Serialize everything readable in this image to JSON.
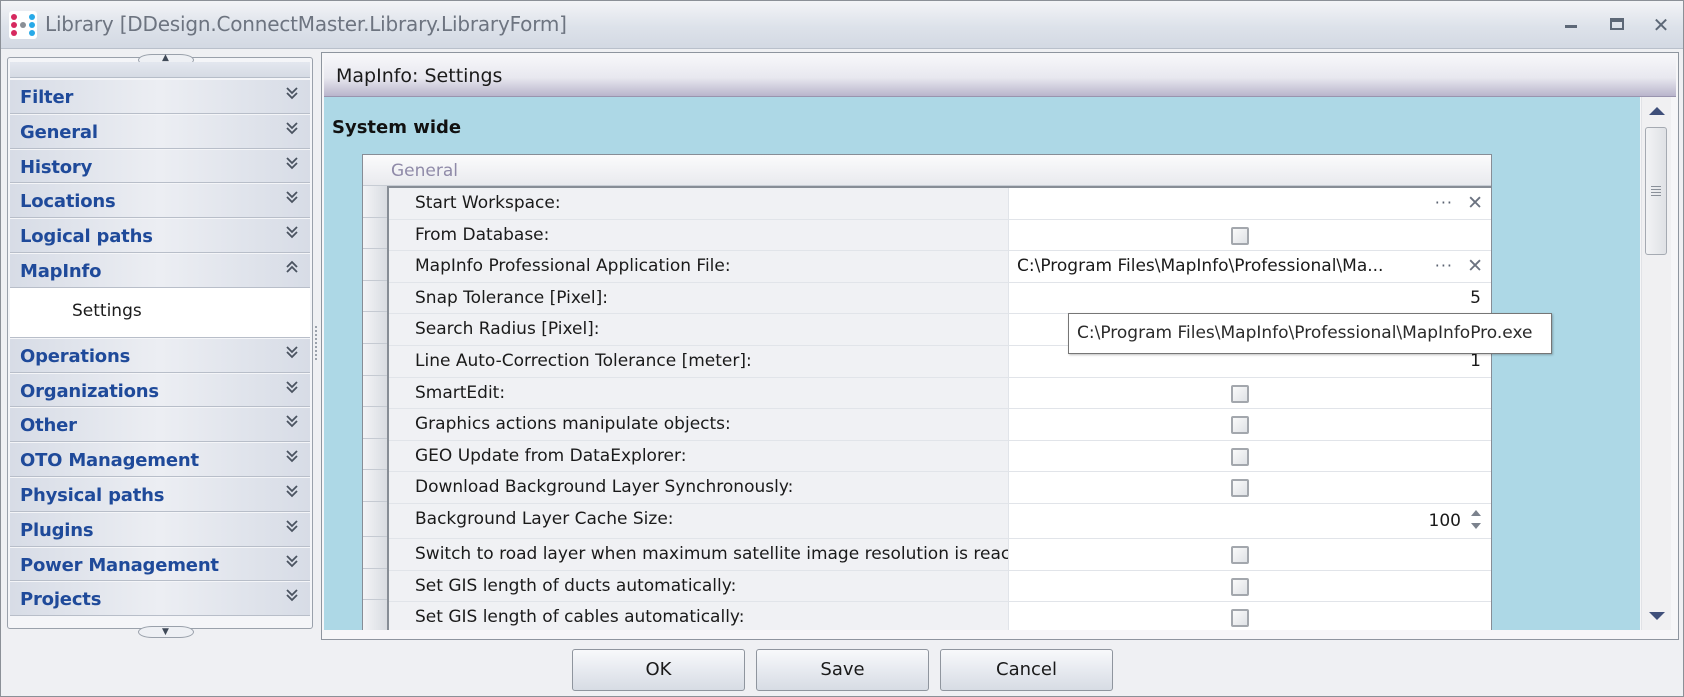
{
  "window": {
    "title": "Library [DDesign.ConnectMaster.Library.LibraryForm]",
    "app_icon": "connectmaster-logo-icon",
    "controls": {
      "minimize": "minimize-icon",
      "maximize": "maximize-icon",
      "close": "close-icon"
    }
  },
  "sidebar": {
    "items": [
      {
        "label": "Filter",
        "expanded": false
      },
      {
        "label": "General",
        "expanded": false
      },
      {
        "label": "History",
        "expanded": false
      },
      {
        "label": "Locations",
        "expanded": false
      },
      {
        "label": "Logical paths",
        "expanded": false
      },
      {
        "label": "MapInfo",
        "expanded": true,
        "children": [
          "Settings"
        ]
      },
      {
        "label": "Operations",
        "expanded": false
      },
      {
        "label": "Organizations",
        "expanded": false
      },
      {
        "label": "Other",
        "expanded": false
      },
      {
        "label": "OTO Management",
        "expanded": false
      },
      {
        "label": "Physical paths",
        "expanded": false
      },
      {
        "label": "Plugins",
        "expanded": false
      },
      {
        "label": "Power Management",
        "expanded": false
      },
      {
        "label": "Projects",
        "expanded": false
      }
    ],
    "chevron_collapsed": "»",
    "chevron_expanded": "«"
  },
  "panel": {
    "title": "MapInfo: Settings",
    "section_title": "System wide",
    "group_title": "General",
    "rows": [
      {
        "label": "Start Workspace:",
        "type": "path",
        "value": ""
      },
      {
        "label": "From Database:",
        "type": "checkbox",
        "checked": false
      },
      {
        "label": "MapInfo Professional Application File:",
        "type": "path",
        "value": "C:\\Program Files\\MapInfo\\Professional\\Ma..."
      },
      {
        "label": "Snap Tolerance [Pixel]:",
        "type": "number",
        "value": "5"
      },
      {
        "label": "Search Radius [Pixel]:",
        "type": "number",
        "value": ""
      },
      {
        "label": "Line Auto-Correction Tolerance [meter]:",
        "type": "number",
        "value": "1"
      },
      {
        "label": "SmartEdit:",
        "type": "checkbox",
        "checked": false
      },
      {
        "label": "Graphics actions manipulate objects:",
        "type": "checkbox",
        "checked": false
      },
      {
        "label": "GEO Update from DataExplorer:",
        "type": "checkbox",
        "checked": false
      },
      {
        "label": "Download Background Layer Synchronously:",
        "type": "checkbox",
        "checked": false
      },
      {
        "label": "Background Layer Cache Size:",
        "type": "spinner",
        "value": "100"
      },
      {
        "label": "Switch to road layer when maximum satellite image resolution is reached:",
        "type": "checkbox",
        "checked": false
      },
      {
        "label": "Set GIS length of ducts automatically:",
        "type": "checkbox",
        "checked": false
      },
      {
        "label": "Set GIS length of cables automatically:",
        "type": "checkbox",
        "checked": false
      }
    ],
    "ellipsis_label": "···",
    "clear_label": "✕",
    "tooltip": "C:\\Program Files\\MapInfo\\Professional\\MapInfoPro.exe"
  },
  "buttons": {
    "ok": "OK",
    "save": "Save",
    "cancel": "Cancel"
  },
  "colors": {
    "panel_background": "#add8e6",
    "nav_label": "#1f4a9a",
    "group_title": "#8f8aa8"
  }
}
